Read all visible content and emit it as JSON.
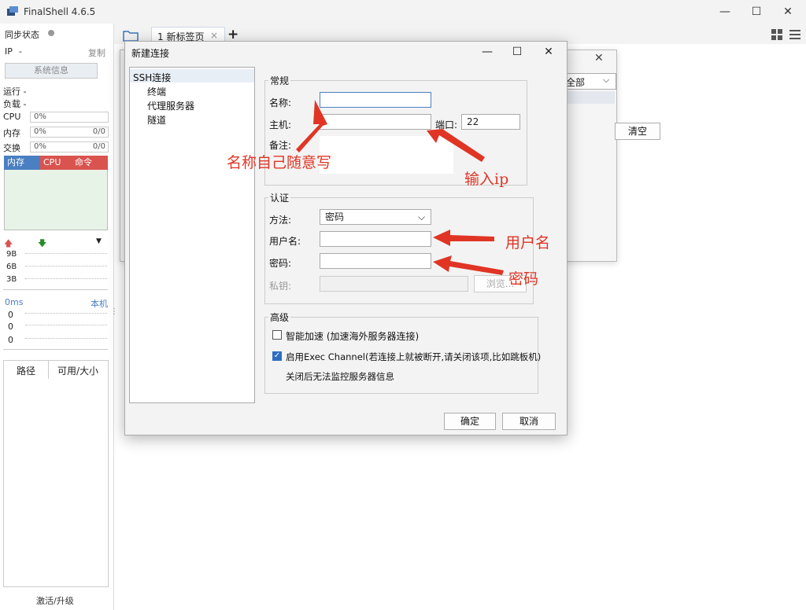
{
  "app": {
    "title": "FinalShell 4.6.5",
    "controls": {
      "minimize": "—",
      "maximize": "☐",
      "close": "✕"
    }
  },
  "sidebar": {
    "sync_label": "同步状态",
    "ip_label": "IP",
    "ip_value": "-",
    "copy_label": "复制",
    "sysinfo_button": "系统信息",
    "run_label": "运行 -",
    "load_label": "负载 -",
    "cpu": {
      "label": "CPU",
      "pct": "0%"
    },
    "mem": {
      "label": "内存",
      "pct": "0%",
      "val": "0/0"
    },
    "swap": {
      "label": "交换",
      "pct": "0%",
      "val": "0/0"
    },
    "proc_tabs": [
      "内存",
      "CPU",
      "命令"
    ],
    "net_levels": [
      "9B",
      "6B",
      "3B"
    ],
    "latency_label": "0ms",
    "local_label": "本机",
    "latency_values": [
      "0",
      "0",
      "0"
    ],
    "files_cols": [
      "路径",
      "可用/大小"
    ],
    "upgrade": "激活/升级"
  },
  "tabs": {
    "active": "1 新标签页",
    "close": "×",
    "add": "+"
  },
  "bg_dialog": {
    "filter_value": "全部",
    "clear_button": "清空"
  },
  "dialog": {
    "title": "新建连接",
    "tree": [
      "SSH连接",
      "终端",
      "代理服务器",
      "隧道"
    ],
    "general": {
      "title": "常规",
      "name_label": "名称:",
      "name_value": "",
      "host_label": "主机:",
      "host_value": "",
      "port_label": "端口:",
      "port_value": "22",
      "note_label": "备注:"
    },
    "auth": {
      "title": "认证",
      "method_label": "方法:",
      "method_value": "密码",
      "user_label": "用户名:",
      "password_label": "密码:",
      "key_label": "私钥:",
      "browse_button": "浏览..."
    },
    "advanced": {
      "title": "高级",
      "smart_accel": "智能加速 (加速海外服务器连接)",
      "exec_channel": "启用Exec Channel(若连接上就被断开,请关闭该项,比如跳板机)",
      "exec_note": "关闭后无法监控服务器信息",
      "smart_accel_checked": false,
      "exec_channel_checked": true
    },
    "ok_button": "确定",
    "cancel_button": "取消"
  },
  "annotations": {
    "name_hint": "名称自己随意写",
    "ip_hint": "输入ip",
    "user_hint": "用户名",
    "password_hint": "密码",
    "color": "#e03525"
  },
  "colors": {
    "accent": "#4a7fc1",
    "sidebar_tab_cpu": "#d9534f",
    "sidebar_tab_cmd": "#d9534f"
  }
}
